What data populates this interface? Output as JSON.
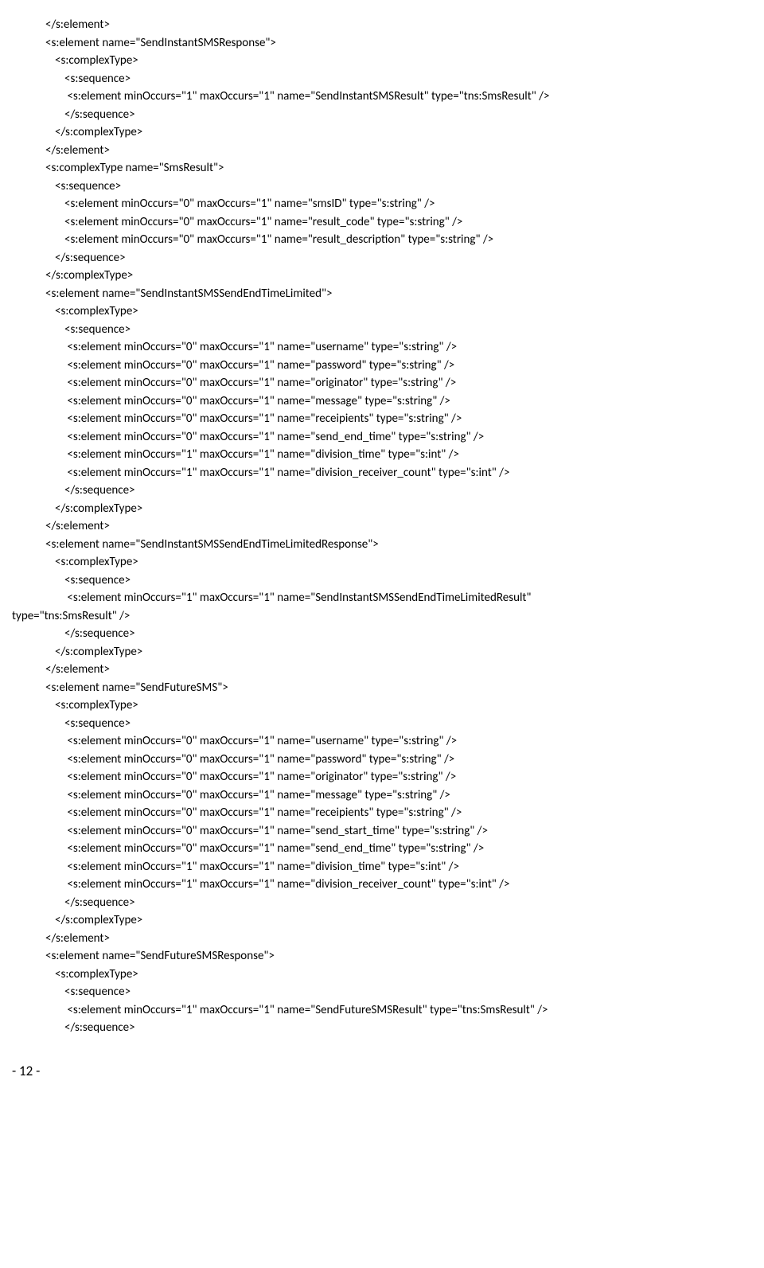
{
  "lines": [
    {
      "cls": "i1",
      "text": "</s:element>"
    },
    {
      "cls": "i1",
      "text": "<s:element name=\"SendInstantSMSResponse\">"
    },
    {
      "cls": "i2",
      "text": "<s:complexType>"
    },
    {
      "cls": "i3",
      "text": "<s:sequence>"
    },
    {
      "cls": "i3",
      "text": " <s:element minOccurs=\"1\" maxOccurs=\"1\" name=\"SendInstantSMSResult\" type=\"tns:SmsResult\" />"
    },
    {
      "cls": "i3",
      "text": "</s:sequence>"
    },
    {
      "cls": "i2",
      "text": "</s:complexType>"
    },
    {
      "cls": "i1",
      "text": "</s:element>"
    },
    {
      "cls": "i1",
      "text": "<s:complexType name=\"SmsResult\">"
    },
    {
      "cls": "i2",
      "text": "<s:sequence>"
    },
    {
      "cls": "i3",
      "text": "<s:element minOccurs=\"0\" maxOccurs=\"1\" name=\"smsID\" type=\"s:string\" />"
    },
    {
      "cls": "i3",
      "text": "<s:element minOccurs=\"0\" maxOccurs=\"1\" name=\"result_code\" type=\"s:string\" />"
    },
    {
      "cls": "i3",
      "text": "<s:element minOccurs=\"0\" maxOccurs=\"1\" name=\"result_description\" type=\"s:string\" />"
    },
    {
      "cls": "i2",
      "text": "</s:sequence>"
    },
    {
      "cls": "i1",
      "text": "</s:complexType>"
    },
    {
      "cls": "i1",
      "text": "<s:element name=\"SendInstantSMSSendEndTimeLimited\">"
    },
    {
      "cls": "i2",
      "text": "<s:complexType>"
    },
    {
      "cls": "i3",
      "text": "<s:sequence>"
    },
    {
      "cls": "i3",
      "text": " <s:element minOccurs=\"0\" maxOccurs=\"1\" name=\"username\" type=\"s:string\" />"
    },
    {
      "cls": "i3",
      "text": " <s:element minOccurs=\"0\" maxOccurs=\"1\" name=\"password\" type=\"s:string\" />"
    },
    {
      "cls": "i3",
      "text": " <s:element minOccurs=\"0\" maxOccurs=\"1\" name=\"originator\" type=\"s:string\" />"
    },
    {
      "cls": "i3",
      "text": " <s:element minOccurs=\"0\" maxOccurs=\"1\" name=\"message\" type=\"s:string\" />"
    },
    {
      "cls": "i3",
      "text": " <s:element minOccurs=\"0\" maxOccurs=\"1\" name=\"receipients\" type=\"s:string\" />"
    },
    {
      "cls": "i3",
      "text": " <s:element minOccurs=\"0\" maxOccurs=\"1\" name=\"send_end_time\" type=\"s:string\" />"
    },
    {
      "cls": "i3",
      "text": " <s:element minOccurs=\"1\" maxOccurs=\"1\" name=\"division_time\" type=\"s:int\" />"
    },
    {
      "cls": "i3",
      "text": " <s:element minOccurs=\"1\" maxOccurs=\"1\" name=\"division_receiver_count\" type=\"s:int\" />"
    },
    {
      "cls": "i3",
      "text": "</s:sequence>"
    },
    {
      "cls": "i2",
      "text": "</s:complexType>"
    },
    {
      "cls": "i1",
      "text": "</s:element>"
    },
    {
      "cls": "i1",
      "text": "<s:element name=\"SendInstantSMSSendEndTimeLimitedResponse\">"
    },
    {
      "cls": "i2",
      "text": "<s:complexType>"
    },
    {
      "cls": "i3",
      "text": "<s:sequence>"
    },
    {
      "cls": "i3",
      "text": " <s:element minOccurs=\"1\" maxOccurs=\"1\" name=\"SendInstantSMSSendEndTimeLimitedResult\""
    },
    {
      "cls": "iL",
      "text": "type=\"tns:SmsResult\" />"
    },
    {
      "cls": "i3",
      "text": "</s:sequence>"
    },
    {
      "cls": "i2",
      "text": "</s:complexType>"
    },
    {
      "cls": "i1",
      "text": "</s:element>"
    },
    {
      "cls": "i1",
      "text": "<s:element name=\"SendFutureSMS\">"
    },
    {
      "cls": "i2",
      "text": "<s:complexType>"
    },
    {
      "cls": "i3",
      "text": "<s:sequence>"
    },
    {
      "cls": "i3",
      "text": " <s:element minOccurs=\"0\" maxOccurs=\"1\" name=\"username\" type=\"s:string\" />"
    },
    {
      "cls": "i3",
      "text": " <s:element minOccurs=\"0\" maxOccurs=\"1\" name=\"password\" type=\"s:string\" />"
    },
    {
      "cls": "i3",
      "text": " <s:element minOccurs=\"0\" maxOccurs=\"1\" name=\"originator\" type=\"s:string\" />"
    },
    {
      "cls": "i3",
      "text": " <s:element minOccurs=\"0\" maxOccurs=\"1\" name=\"message\" type=\"s:string\" />"
    },
    {
      "cls": "i3",
      "text": " <s:element minOccurs=\"0\" maxOccurs=\"1\" name=\"receipients\" type=\"s:string\" />"
    },
    {
      "cls": "i3",
      "text": " <s:element minOccurs=\"0\" maxOccurs=\"1\" name=\"send_start_time\" type=\"s:string\" />"
    },
    {
      "cls": "i3",
      "text": " <s:element minOccurs=\"0\" maxOccurs=\"1\" name=\"send_end_time\" type=\"s:string\" />"
    },
    {
      "cls": "i3",
      "text": " <s:element minOccurs=\"1\" maxOccurs=\"1\" name=\"division_time\" type=\"s:int\" />"
    },
    {
      "cls": "i3",
      "text": " <s:element minOccurs=\"1\" maxOccurs=\"1\" name=\"division_receiver_count\" type=\"s:int\" />"
    },
    {
      "cls": "i3",
      "text": "</s:sequence>"
    },
    {
      "cls": "i2",
      "text": "</s:complexType>"
    },
    {
      "cls": "i1",
      "text": "</s:element>"
    },
    {
      "cls": "i1",
      "text": "<s:element name=\"SendFutureSMSResponse\">"
    },
    {
      "cls": "i2",
      "text": "<s:complexType>"
    },
    {
      "cls": "i3",
      "text": "<s:sequence>"
    },
    {
      "cls": "i3",
      "text": " <s:element minOccurs=\"1\" maxOccurs=\"1\" name=\"SendFutureSMSResult\" type=\"tns:SmsResult\" />"
    },
    {
      "cls": "i3",
      "text": "</s:sequence>"
    }
  ],
  "page_number": "- 12 -"
}
